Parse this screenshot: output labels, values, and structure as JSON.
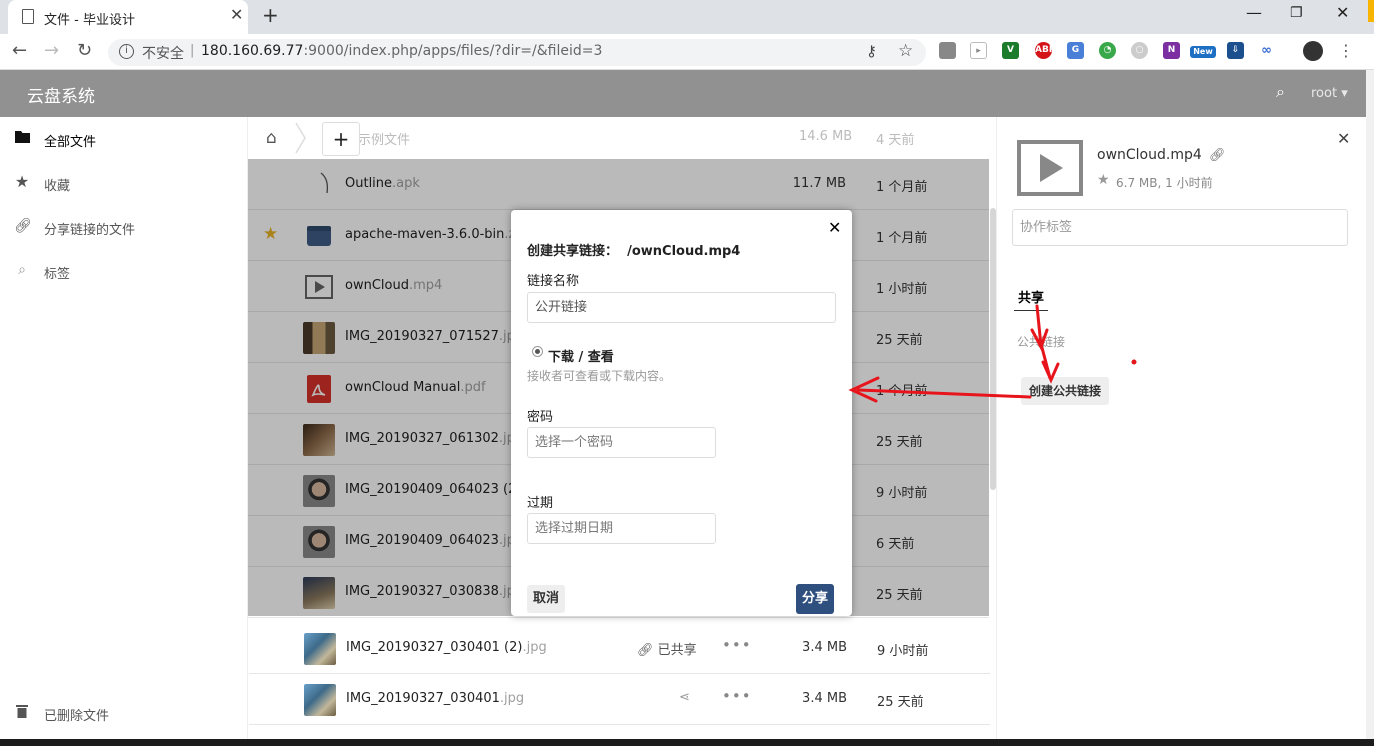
{
  "browser": {
    "tab_title": "文件 - 毕业设计",
    "security_label": "不安全",
    "url_host": "180.160.69.77",
    "url_rest": ":9000/index.php/apps/files/?dir=/&fileid=3"
  },
  "app": {
    "title": "云盘系统",
    "user": "root ▾"
  },
  "sidebar": {
    "items": [
      {
        "label": "全部文件",
        "icon": "folder-icon"
      },
      {
        "label": "收藏",
        "icon": "star-icon"
      },
      {
        "label": "分享链接的文件",
        "icon": "link-icon"
      },
      {
        "label": "标签",
        "icon": "search-icon"
      }
    ],
    "trash_label": "已删除文件"
  },
  "breadcrumb": {
    "partial_row_name": "示例文件",
    "partial_row_size": "14.6 MB",
    "partial_row_time": "4 天前"
  },
  "files": [
    {
      "base": "Outline",
      "ext": ".apk",
      "size": "11.7 MB",
      "time": "1 个月前",
      "favorite": false,
      "thumb": "apk"
    },
    {
      "base": "apache-maven-3.6.0-bin",
      "ext": ".zip",
      "size": "",
      "time": "1 个月前",
      "favorite": true,
      "thumb": "zip"
    },
    {
      "base": "ownCloud",
      "ext": ".mp4",
      "size": "",
      "time": "1 小时前",
      "favorite": false,
      "thumb": "video"
    },
    {
      "base": "IMG_20190327_071527",
      "ext": ".jpg",
      "size": "",
      "time": "25 天前",
      "favorite": false,
      "thumb": "photo1"
    },
    {
      "base": "ownCloud Manual",
      "ext": ".pdf",
      "size": "",
      "time": "1 个月前",
      "favorite": false,
      "thumb": "pdf"
    },
    {
      "base": "IMG_20190327_061302",
      "ext": ".jpg",
      "size": "",
      "time": "25 天前",
      "favorite": false,
      "thumb": "photo2"
    },
    {
      "base": "IMG_20190409_064023 (2)",
      "ext": ".jpg",
      "size": "",
      "time": "9 小时前",
      "favorite": false,
      "thumb": "photo3"
    },
    {
      "base": "IMG_20190409_064023",
      "ext": ".jpg",
      "size": "",
      "time": "6 天前",
      "favorite": false,
      "thumb": "photo3"
    },
    {
      "base": "IMG_20190327_030838",
      "ext": ".jpg",
      "size": "",
      "time": "25 天前",
      "favorite": false,
      "thumb": "photo4"
    },
    {
      "base": "IMG_20190327_030401 (2)",
      "ext": ".jpg",
      "size": "3.4 MB",
      "time": "9 小时前",
      "favorite": false,
      "thumb": "photo5",
      "shared_label": "已共享"
    },
    {
      "base": "IMG_20190327_030401",
      "ext": ".jpg",
      "size": "3.4 MB",
      "time": "25 天前",
      "favorite": false,
      "thumb": "photo5"
    }
  ],
  "details": {
    "file_name": "ownCloud.mp4",
    "meta": "6.7 MB, 1 小时前",
    "tags_placeholder": "协作标签",
    "share_tab": "共享",
    "public_links_label": "公共链接",
    "create_public_link": "创建公共链接"
  },
  "modal": {
    "title_prefix": "创建共享链接：",
    "title_path": "/ownCloud.mp4",
    "link_name_label": "链接名称",
    "link_name_value": "公开链接",
    "permission_label": "下载 / 查看",
    "permission_hint": "接收者可查看或下载内容。",
    "password_label": "密码",
    "password_placeholder": "选择一个密码",
    "expiry_label": "过期",
    "expiry_placeholder": "选择过期日期",
    "cancel": "取消",
    "share": "分享"
  },
  "colors": {
    "header_bg": "#919191",
    "primary_button": "#2f4f7e",
    "annotation_red": "#e8141c",
    "favorite_star": "#e8b425"
  }
}
